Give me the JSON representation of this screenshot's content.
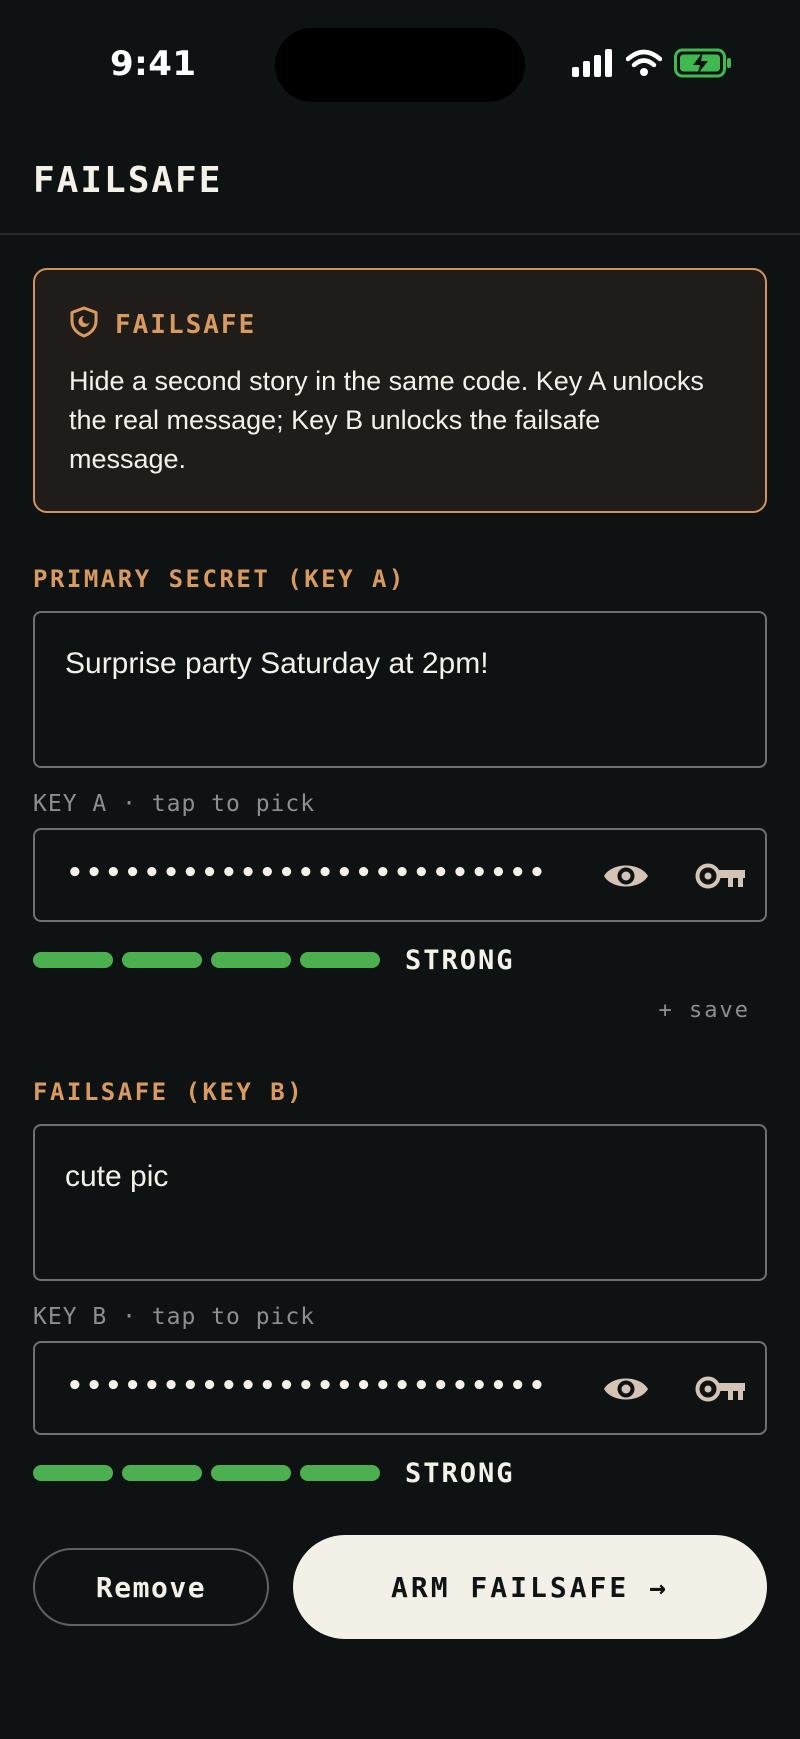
{
  "status_bar": {
    "time": "9:41",
    "icons": [
      "signal-icon",
      "wifi-icon",
      "battery-charging-icon"
    ],
    "battery_color": "#3fb950"
  },
  "header": {
    "title": "FAILSAFE"
  },
  "info": {
    "icon": "shield-icon",
    "title": "FAILSAFE",
    "body": "Hide a second story in the same code. Key A unlocks the real message; Key B unlocks the failsafe message."
  },
  "primary": {
    "label": "PRIMARY SECRET (KEY A)",
    "message": "Surprise party Saturday at 2pm!",
    "key_caption": "KEY A · tap to pick",
    "key_masked": "•••••••••••••••••••••••••",
    "strength_segments": 4,
    "strength_label": "STRONG",
    "save_link": "+ save"
  },
  "failsafe": {
    "label": "FAILSAFE (KEY B)",
    "message": "cute pic",
    "key_caption": "KEY B · tap to pick",
    "key_masked": "•••••••••••••••••••••••••",
    "strength_segments": 4,
    "strength_label": "STRONG"
  },
  "actions": {
    "remove_label": "Remove",
    "arm_label": "ARM FAILSAFE →"
  },
  "colors": {
    "background": "#0f1213",
    "accent": "#d99a5f",
    "strength": "#4caf50",
    "primary_button": "#f3f0e8"
  }
}
